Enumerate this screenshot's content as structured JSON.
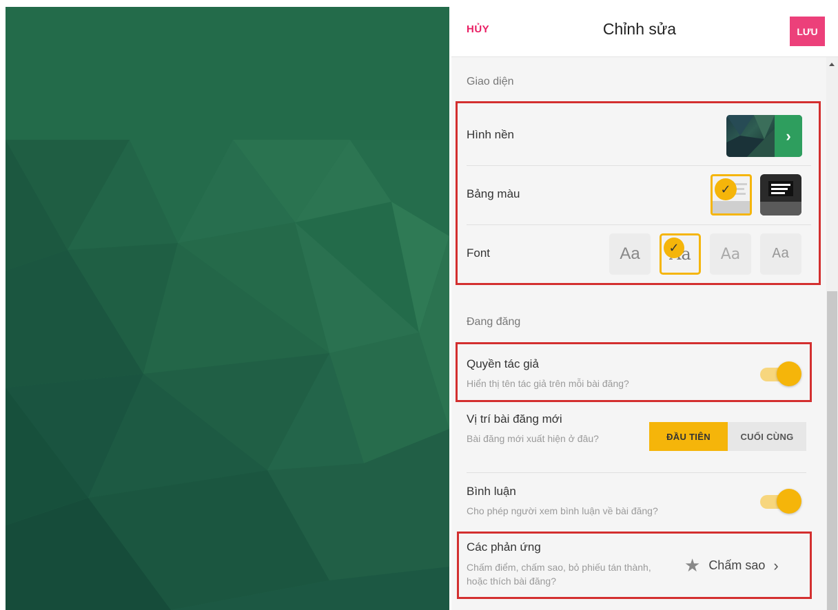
{
  "header": {
    "cancel_label": "HỦY",
    "title": "Chỉnh sửa",
    "save_label": "LƯU"
  },
  "appearance": {
    "section_label": "Giao diện",
    "wallpaper_label": "Hình nền",
    "palette_label": "Bảng màu",
    "font_label": "Font",
    "font_options": [
      "Aa",
      "Aa",
      "Aa",
      "Aa"
    ],
    "selected_font_index": 1,
    "selected_palette_index": 0
  },
  "posting": {
    "section_label": "Đang đăng",
    "author": {
      "label": "Quyền tác giả",
      "description": "Hiển thị tên tác giả trên mỗi bài đăng?",
      "enabled": true
    },
    "new_post_position": {
      "label": "Vị trí bài đăng mới",
      "description": "Bài đăng mới xuất hiện ở đâu?",
      "options": [
        "ĐẦU TIÊN",
        "CUỐI CÙNG"
      ],
      "selected": "ĐẦU TIÊN"
    },
    "comments": {
      "label": "Bình luận",
      "description": "Cho phép người xem bình luận về bài đăng?",
      "enabled": true
    },
    "reactions": {
      "label": "Các phản ứng",
      "description": "Chấm điểm, chấm sao, bỏ phiếu tán thành, hoặc thích bài đăng?",
      "value": "Chấm sao"
    }
  },
  "colors": {
    "accent": "#f5b50a",
    "save_button": "#ec407a",
    "cancel_text": "#e91e63",
    "highlight": "#d32f2f",
    "background_green": "#236b4a"
  },
  "icons": {
    "wallpaper_arrow": "chevron-right-icon",
    "check": "check-icon",
    "reaction_star": "star-icon",
    "reaction_chevron": "chevron-right-icon"
  }
}
